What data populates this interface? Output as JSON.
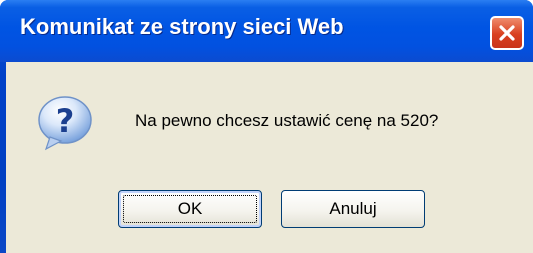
{
  "window": {
    "title": "Komunikat ze strony sieci Web",
    "close_icon": "close-icon"
  },
  "dialog": {
    "icon": "question-icon",
    "message": "Na pewno chcesz ustawić cenę na 520?",
    "buttons": {
      "ok_label": "OK",
      "cancel_label": "Anuluj"
    }
  },
  "colors": {
    "titlebar": "#0054e3",
    "client": "#ece9d8",
    "close": "#d9401f"
  }
}
